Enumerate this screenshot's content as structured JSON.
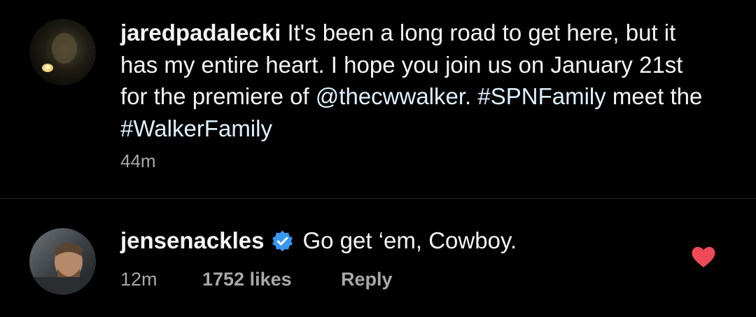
{
  "post": {
    "author": "jaredpadalecki",
    "text_part1": " It's been a long road to get here, but it has my entire heart.  I hope you join us on January 21st for the premiere of ",
    "mention": "@thecwwalker",
    "text_part2": ". ",
    "hashtag1": "#SPNFamily",
    "text_part3": " meet the ",
    "hashtag2": "#WalkerFamily",
    "time": "44m"
  },
  "comment": {
    "author": "jensenackles",
    "verified": true,
    "text": "Go get ‘em, Cowboy.",
    "time": "12m",
    "likes": "1752 likes",
    "reply_label": "Reply",
    "liked": true
  },
  "colors": {
    "background": "#000000",
    "text": "#f5f5f5",
    "secondary": "#a8a8a8",
    "link": "#e0f1ff",
    "verified": "#3897f0",
    "heart": "#ed4956"
  },
  "icons": {
    "verified": "verified-badge-icon",
    "like": "heart-icon"
  }
}
